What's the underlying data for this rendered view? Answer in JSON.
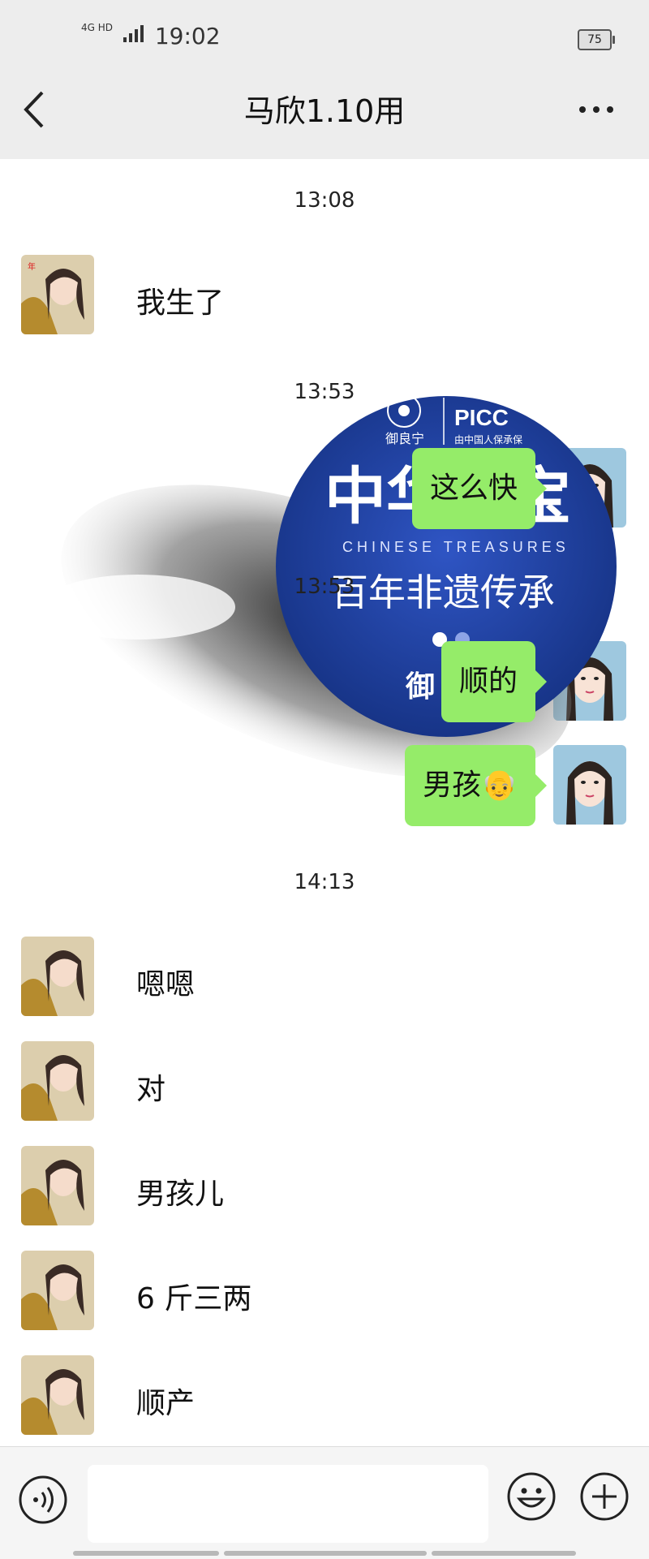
{
  "status_bar": {
    "network": "4G HD",
    "time": "19:02",
    "battery": "75"
  },
  "header": {
    "title": "马欣1.10用"
  },
  "promo_image": {
    "brand": "御良宁",
    "partner": "PICC",
    "partner_sub": "由中国人保承保",
    "headline": "中华瑰宝",
    "subtitle_en": "CHINESE TREASURES",
    "slogan": "百年非遗传承",
    "footer_char": "御"
  },
  "messages": {
    "ts1": "13:08",
    "m1": "我生了",
    "ts2": "13:53",
    "m2": "这么快",
    "ts3": "13:53",
    "m3": "顺的",
    "m4": "男孩👴",
    "ts4": "14:13",
    "m5": "嗯嗯",
    "m6": "对",
    "m7": "男孩儿",
    "m8": "6 斤三两",
    "m9": "顺产"
  },
  "colors": {
    "header_bg": "#ededed",
    "bubble_green": "#95ec69",
    "promo_blue": "#1e3f9c"
  }
}
